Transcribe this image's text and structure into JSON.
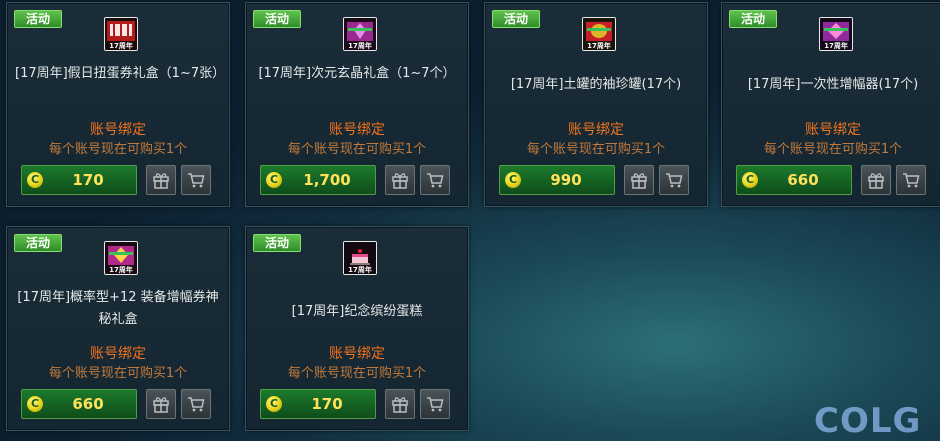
{
  "items": [
    {
      "badge": "活动",
      "title": "[17周年]假日扭蛋券礼盒（1~7张）",
      "bind": "账号绑定",
      "limit": "每个账号现在可购买1个",
      "price": "170",
      "icon": "gacha-ticket-box-icon",
      "icon_text": "17周年",
      "icon_color": "#b41c1c",
      "coin_symbol": "C"
    },
    {
      "badge": "活动",
      "title": "[17周年]次元玄晶礼盒（1~7个）",
      "bind": "账号绑定",
      "limit": "每个账号现在可购买1个",
      "price": "1,700",
      "icon": "crystal-box-icon",
      "icon_text": "17周年",
      "icon_color": "#9a2a8e",
      "coin_symbol": "C"
    },
    {
      "badge": "活动",
      "title": "[17周年]土罐的袖珍罐(17个)",
      "bind": "账号绑定",
      "limit": "每个账号现在可购买1个",
      "price": "990",
      "icon": "pocket-jar-icon",
      "icon_text": "17周年",
      "icon_color": "#a88a14",
      "coin_symbol": "C"
    },
    {
      "badge": "活动",
      "title": "[17周年]一次性增幅器(17个)",
      "bind": "账号绑定",
      "limit": "每个账号现在可购买1个",
      "price": "660",
      "icon": "amplifier-icon",
      "icon_text": "17周年",
      "icon_color": "#8e2a9c",
      "coin_symbol": "C"
    },
    {
      "badge": "活动",
      "title": "[17周年]概率型+12 装备增幅券神秘礼盒",
      "bind": "账号绑定",
      "limit": "每个账号现在可购买1个",
      "price": "660",
      "icon": "mystery-box-icon",
      "icon_text": "17周年",
      "icon_color": "#b02a8a",
      "coin_symbol": "C"
    },
    {
      "badge": "活动",
      "title": "[17周年]纪念缤纷蛋糕",
      "bind": "账号绑定",
      "limit": "每个账号现在可购买1个",
      "price": "170",
      "icon": "cake-icon",
      "icon_text": "17周年",
      "icon_color": "#6e2a4a",
      "coin_symbol": "C"
    }
  ],
  "watermark": "COLG"
}
